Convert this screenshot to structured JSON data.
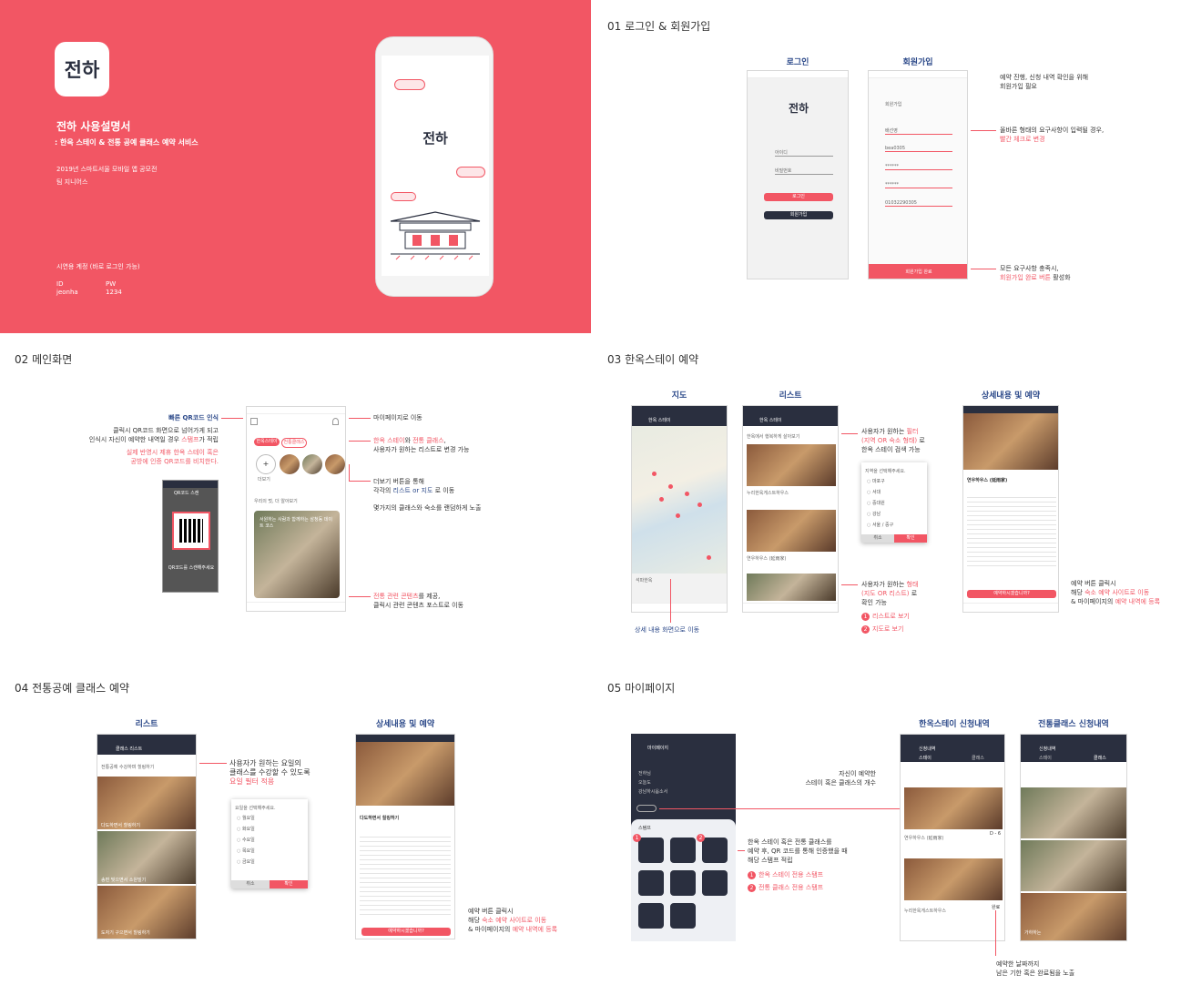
{
  "cover": {
    "logo": "전하",
    "title": "전하 사용설명서",
    "subtitle": ": 한옥 스테이 & 전통 공예 클래스 예약 서비스",
    "contest": "2019년 스마트서울 모바일 앱 공모전",
    "team": "팀 지니어스",
    "demo": "시연용 계정 (바로 로그인 가능)",
    "id_label": "ID",
    "id_value": "jeonha",
    "pw_label": "PW",
    "pw_value": "1234",
    "phone_logo": "전하"
  },
  "s01": {
    "title": "01 로그인 & 회원가입",
    "login_label": "로그인",
    "signup_label": "회원가입",
    "login_logo": "전하",
    "id_ph": "아이디",
    "pw_ph": "비밀번호",
    "login_btn": "로그인",
    "signup_btn": "회원가입",
    "signup_header": "회원가입",
    "fields": [
      "배선영",
      "bea0305",
      "******",
      "******",
      "01032290305"
    ],
    "complete_btn": "회원가입 완료",
    "note1": "예약 진행, 신청 내역 확인을 위해\n회원가입 필요",
    "note2a": "올바른 형태의 요구사항이 입력될 경우,",
    "note2b": "빨간 체크로 변경",
    "note3a": "모든 요구사항 충족시,",
    "note3b": "회원가입 완료 버튼",
    "note3c": " 활성화"
  },
  "s02": {
    "title": "02 메인화면",
    "qr_title": "빠른 QR코드 인식",
    "qr_note": "클릭시 QR코드 화면으로 넘어가게 되고\n인식시 자신이 예약한 내역일 경우 ",
    "qr_stamp": "스탬프",
    "qr_note2": "가 적립",
    "qr_red": "실제 반영시 제휴 한옥 스테이 혹은\n공방에 인증 QR코드를 비치한다.",
    "qr_header": "QR코드 스캔",
    "qr_footer": "QR코드를 스캔해주세요",
    "mypage": "마이페이지로 이동",
    "toggle_a": "한옥 스테이",
    "toggle_mid": "와 ",
    "toggle_b": "전통 클래스",
    "toggle_end": ",",
    "toggle_note": "사용자가 원하는 리스트로 변경 가능",
    "chip_a": "한옥스테이",
    "chip_b": "전통클래스",
    "more_label": "더보기",
    "more_note": "더보기 버튼을 통해",
    "more_note2a": "각각의 ",
    "more_note2b": "리스트 or 지도",
    "more_note2c": " 로 이동",
    "random_note": "몇가지의 클래스와 숙소를 랜덤하게 노출",
    "section_head": "우리의 멋, 더 알아보기",
    "poster_text": "서원하는 사람과 함께하는 삼청동 데이트 코스",
    "content_a": "전통 관련 콘텐츠",
    "content_b": "를 제공,",
    "content_c": "클릭시 관련 콘텐츠 포스트로 이동"
  },
  "s03": {
    "title": "03 한옥스테이 예약",
    "map_label": "지도",
    "list_label": "리스트",
    "detail_label": "상세내용 및 예약",
    "map_header": "한옥 스테이",
    "list_header": "한옥 스테이",
    "list_search": "한옥에서 행복하게 살아보기",
    "map_place": "석파한옥",
    "filter_a": "사용자가 원하는 ",
    "filter_b": "필터",
    "filter_c": "(지역 OR 숙소 형태)",
    "filter_d": " 로",
    "filter_e": "한옥 스테이 검색 가능",
    "filter_title": "지역을 선택해주세요.",
    "filter_opts": [
      "마포구",
      "서대",
      "중대원",
      "강남",
      "서울 / 중구"
    ],
    "filter_cancel": "취소",
    "filter_ok": "확인",
    "view_a": "사용자가 원하는 ",
    "view_b": "형태",
    "view_c": "(지도 OR 리스트)",
    "view_d": " 로",
    "view_e": "확인 가능",
    "opt1": "리스트로 보기",
    "opt2": "지도로 보기",
    "detail_move": "상세 내용 화면으로 이동",
    "detail_name": "연우하우스 (延雨家)",
    "detail_reserve": "예약하시겠습니까?",
    "detail_note1": "예약 버튼 클릭시",
    "detail_note2a": "해당 ",
    "detail_note2b": "숙소 예약 사이트로 이동",
    "detail_note3a": "& 마이페이지의 ",
    "detail_note3b": "예약 내역에 등록",
    "list_item1": "누리한옥게스트하우스",
    "list_item2": "연우하우스 (延雨家)"
  },
  "s04": {
    "title": "04 전통공예 클래스 예약",
    "list_label": "리스트",
    "detail_label": "상세내용 및 예약",
    "list_header": "클래스 리스트",
    "list_search": "전통공예 수강하며 힐링하기",
    "items": [
      "다도하면서 힐링하기",
      "송편 빚으면서 소원빌기",
      "도자기 구으면서 힐링하기"
    ],
    "day_a": "사용자가 원하는 요일의",
    "day_b": "클래스를 수강할 수 있도록",
    "day_c": "요일 필터 적용",
    "day_title": "요일을 선택해주세요.",
    "days": [
      "월요일",
      "화요일",
      "수요일",
      "목요일",
      "금요일"
    ],
    "cancel": "취소",
    "ok": "확인",
    "detail_name": "다도하면서 힐링하기",
    "detail_reserve": "예약하시겠습니까?",
    "note1": "예약 버튼 클릭시",
    "note2a": "해당 ",
    "note2b": "숙소 예약 사이트로 이동",
    "note3a": "& 마이페이지의 ",
    "note3b": "예약 내역에 등록"
  },
  "s05": {
    "title": "05 마이페이지",
    "stay_label": "한옥스테이 신청내역",
    "class_label": "전통클래스 신청내역",
    "my_header": "마이페이지",
    "my_lines": [
      "전하님",
      "오늘도",
      "강남하시옵소서"
    ],
    "stamp_label": "스탬프",
    "tab_a": "스테이",
    "tab_b": "클래스",
    "count_note1": "자신이 예약한",
    "count_note2": "스테이 혹은 클래스의 개수",
    "stamp_note1": "한옥 스테이 혹은 전통 클래스를",
    "stamp_note2": "예약 후, QR 코드를 통해 인증했을 때",
    "stamp_note3": "해당 스탬프 적립",
    "legend1": "한옥 스테이 전용 스탬프",
    "legend2": "전통 클래스 전용 스탬프",
    "stay_header": "신청내역",
    "class_header": "신청내역",
    "stay_item1": "연우하우스 (延雨家)",
    "stay_item2": "누리한옥게스트하우스",
    "dday": "D - 6",
    "done": "완료",
    "dday_note1": "예약한 날짜까지",
    "dday_note2": "남은 기한 혹은 완료됨을 노출",
    "class_item": "가하하는"
  }
}
